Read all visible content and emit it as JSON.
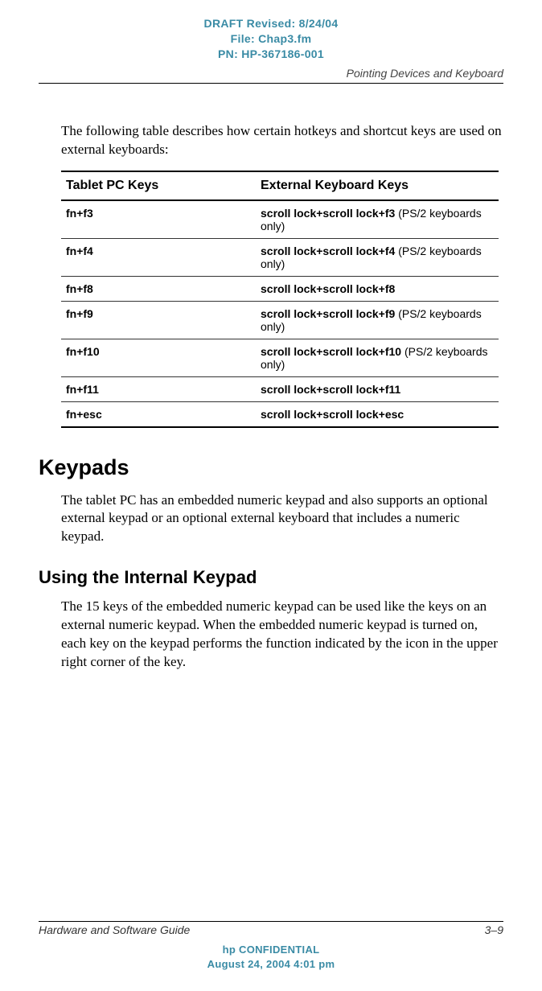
{
  "draftHeader": {
    "line1": "DRAFT Revised: 8/24/04",
    "line2": "File: Chap3.fm",
    "line3": "PN: HP-367186-001"
  },
  "runningHead": "Pointing Devices and Keyboard",
  "introPara": "The following table describes how certain hotkeys and shortcut keys are used on external keyboards:",
  "tableHeaders": {
    "col1": "Tablet PC Keys",
    "col2": "External Keyboard Keys"
  },
  "rows": [
    {
      "col1": "fn+f3",
      "col2bold": "scroll lock+scroll lock+f3",
      "col2note": " (PS/2 keyboards only)"
    },
    {
      "col1": "fn+f4",
      "col2bold": "scroll lock+scroll lock+f4",
      "col2note": " (PS/2 keyboards only)"
    },
    {
      "col1": "fn+f8",
      "col2bold": "scroll lock+scroll lock+f8",
      "col2note": ""
    },
    {
      "col1": "fn+f9",
      "col2bold": "scroll lock+scroll lock+f9",
      "col2note": " (PS/2 keyboards only)"
    },
    {
      "col1": "fn+f10",
      "col2bold": "scroll lock+scroll lock+f10",
      "col2note": " (PS/2 keyboards only)"
    },
    {
      "col1": "fn+f11",
      "col2bold": "scroll lock+scroll lock+f11",
      "col2note": ""
    },
    {
      "col1": "fn+esc",
      "col2bold": "scroll lock+scroll lock+esc",
      "col2note": ""
    }
  ],
  "section1": {
    "heading": "Keypads",
    "para": "The tablet PC has an embedded numeric keypad and also supports an optional external keypad or an optional external keyboard that includes a numeric keypad."
  },
  "section2": {
    "heading": "Using the Internal Keypad",
    "para": "The 15 keys of the embedded numeric keypad can be used like the keys on an external numeric keypad. When the embedded numeric keypad is turned on, each key on the keypad performs the function indicated by the icon in the upper right corner of the key."
  },
  "footer": {
    "left": "Hardware and Software Guide",
    "right": "3–9",
    "conf1": "hp CONFIDENTIAL",
    "conf2": "August 24, 2004 4:01 pm"
  }
}
